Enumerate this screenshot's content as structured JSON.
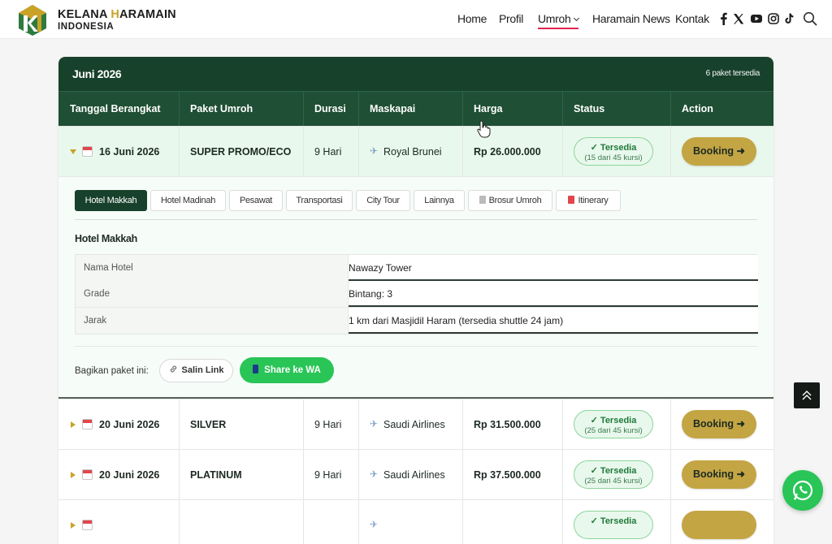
{
  "brand": {
    "name_part1": "KELANA ",
    "name_accent": "H",
    "name_part2": "ARAMAIN",
    "subtitle": "INDONESIA",
    "accent_color": "#c9a227"
  },
  "nav": {
    "items": [
      "Home",
      "Profil",
      "Umroh",
      "Haramain News",
      "Kontak"
    ],
    "active": "Umroh"
  },
  "social_icons": [
    "facebook-icon",
    "x-icon",
    "youtube-icon",
    "instagram-icon",
    "tiktok-icon",
    "search-icon"
  ],
  "schedule": {
    "month": "Juni 2026",
    "count_label": "6 paket tersedia",
    "columns": [
      "Tanggal Berangkat",
      "Paket Umroh",
      "Durasi",
      "Maskapai",
      "Harga",
      "Status",
      "Action"
    ],
    "rows": [
      {
        "date": "16 Juni 2026",
        "package": "SUPER PROMO/ECO",
        "duration": "9 Hari",
        "airline": "Royal Brunei",
        "price": "Rp 26.000.000",
        "status": "✓ Tersedia",
        "seats": "(15 dari 45 kursi)",
        "action": "Booking ➜",
        "expanded": true
      },
      {
        "date": "20 Juni 2026",
        "package": "SILVER",
        "duration": "9 Hari",
        "airline": "Saudi Airlines",
        "price": "Rp 31.500.000",
        "status": "✓ Tersedia",
        "seats": "(25 dari 45 kursi)",
        "action": "Booking ➜",
        "expanded": false
      },
      {
        "date": "20 Juni 2026",
        "package": "PLATINUM",
        "duration": "9 Hari",
        "airline": "Saudi Airlines",
        "price": "Rp 37.500.000",
        "status": "✓ Tersedia",
        "seats": "(25 dari 45 kursi)",
        "action": "Booking ➜",
        "expanded": false
      },
      {
        "status": "✓ Tersedia"
      }
    ]
  },
  "detail": {
    "tabs": [
      "Hotel Makkah",
      "Hotel Madinah",
      "Pesawat",
      "Transportasi",
      "City Tour",
      "Lainnya",
      "Brosur Umroh",
      "Itinerary"
    ],
    "active_tab": "Hotel Makkah",
    "title": "Hotel Makkah",
    "fields": [
      {
        "key": "Nama Hotel",
        "value": "Nawazy Tower"
      },
      {
        "key": "Grade",
        "value": "Bintang: 3"
      },
      {
        "key": "Jarak",
        "value": "1 km dari Masjidil Haram (tersedia shuttle 24 jam)"
      }
    ],
    "share_label": "Bagikan paket ini:",
    "copy_link": "Salin Link",
    "share_wa": "Share ke WA"
  },
  "colors": {
    "header_green": "#17412a",
    "table_head": "#1f4f34",
    "booking_gold": "#c4a544",
    "whatsapp": "#29c557",
    "status_green": "#1f7a3a"
  }
}
